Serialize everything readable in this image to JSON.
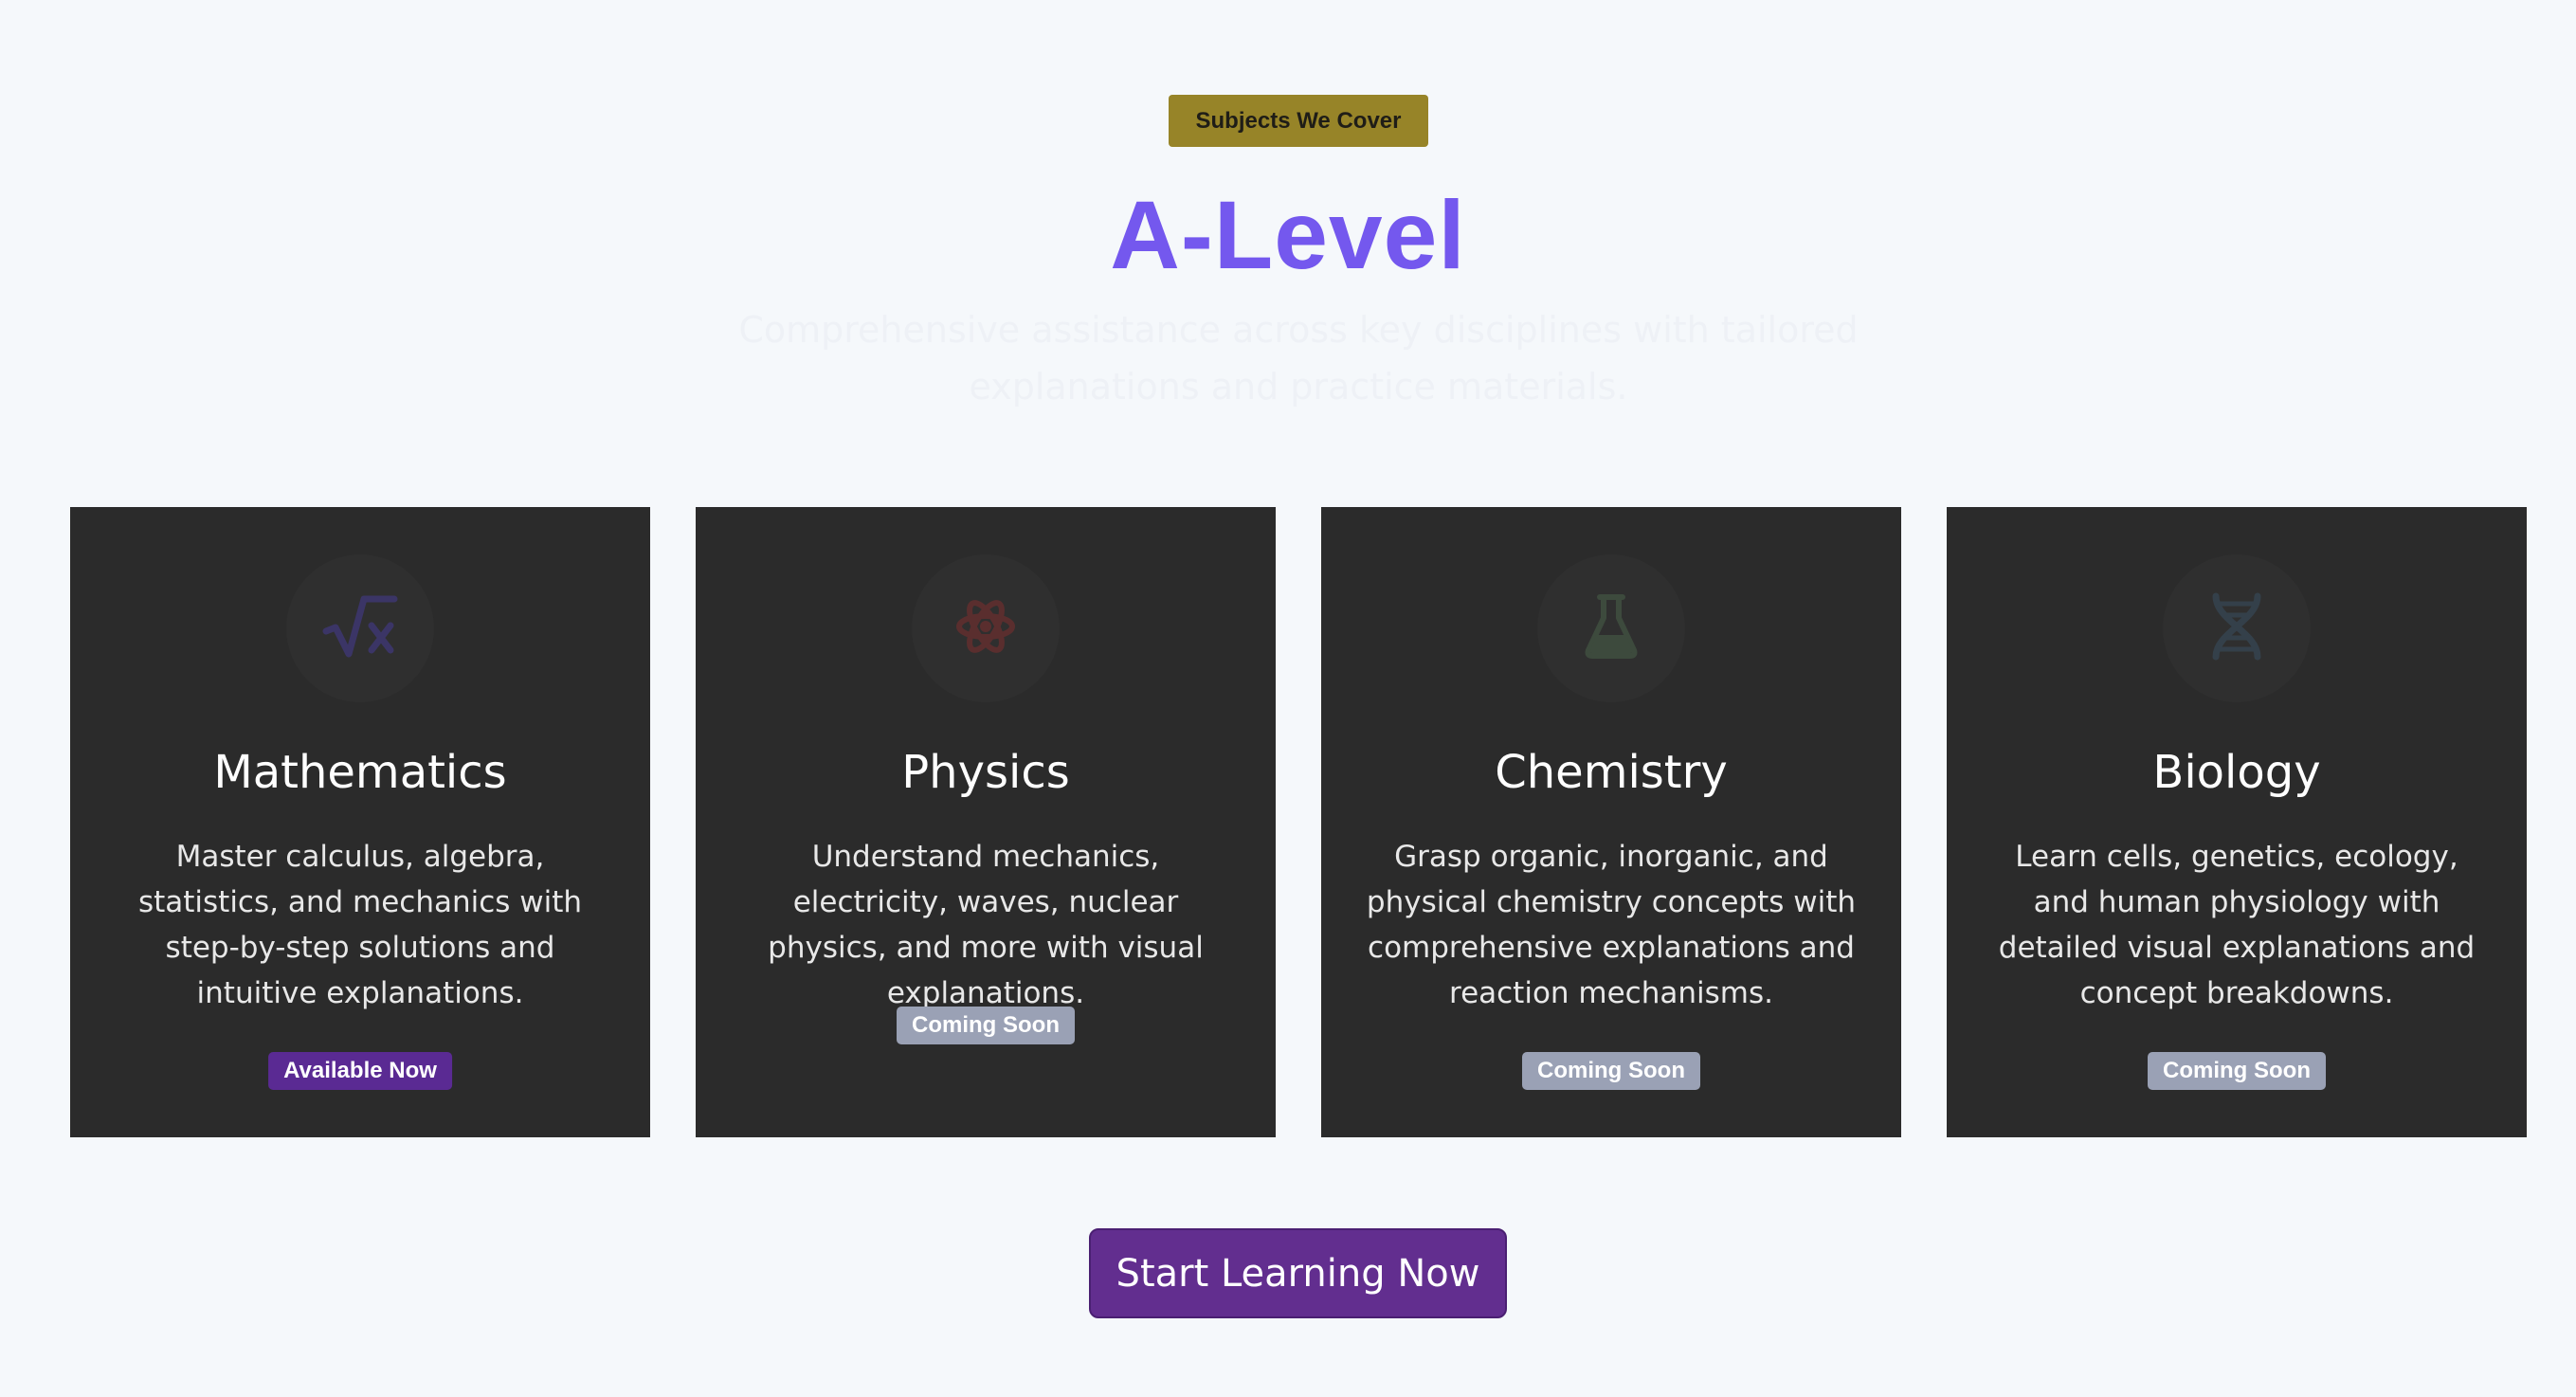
{
  "section": {
    "badge": "Subjects We Cover",
    "title": "A-Level",
    "subtitle": "Comprehensive assistance across key disciplines with tailored explanations and practice materials."
  },
  "colors": {
    "badge_bg": "#978428",
    "title": "#7458ee",
    "card_bg": "#2b2b2b",
    "available_bg": "#5a2a93",
    "soon_bg": "#9aa1b5",
    "cta_bg": "#622e8f",
    "page_bg": "#f5f8fb"
  },
  "subjects": [
    {
      "icon": "square-root-icon",
      "icon_color": "#3b3566",
      "title": "Mathematics",
      "description": "Master calculus, algebra, statistics, and mechanics with step-by-step solutions and intuitive explanations.",
      "status": "Available Now",
      "status_type": "available"
    },
    {
      "icon": "atom-icon",
      "icon_color": "#5a2e2e",
      "title": "Physics",
      "description": "Understand mechanics, electricity, waves, nuclear physics, and more with visual explanations.",
      "status": "Coming Soon",
      "status_type": "soon"
    },
    {
      "icon": "flask-icon",
      "icon_color": "#3d4a3d",
      "title": "Chemistry",
      "description": "Grasp organic, inorganic, and physical chemistry concepts with comprehensive explanations and reaction mechanisms.",
      "status": "Coming Soon",
      "status_type": "soon"
    },
    {
      "icon": "dna-icon",
      "icon_color": "#34404a",
      "title": "Biology",
      "description": "Learn cells, genetics, ecology, and human physiology with detailed visual explanations and concept breakdowns.",
      "status": "Coming Soon",
      "status_type": "soon"
    }
  ],
  "cta": {
    "label": "Start Learning Now"
  }
}
